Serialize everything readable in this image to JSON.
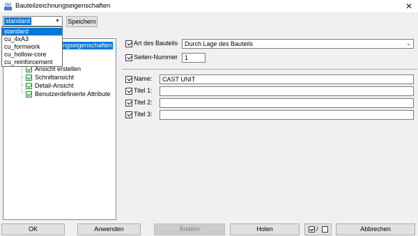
{
  "window": {
    "title": "Bauteilzeichnungseigenschaften",
    "close_glyph": "✕"
  },
  "toolbar": {
    "preset_value": "standard",
    "save_label": "Speichern",
    "preset_options": [
      "standard",
      "cu_4xA3",
      "cu_formwork",
      "cu_hollow-core",
      "cu_reinforcement"
    ]
  },
  "tree": {
    "root_partial_label": "ngseigenschaften",
    "items": [
      "Ansicht erstellen",
      "Schnittansicht",
      "Detail-Ansicht",
      "Benutzerdefinierte Attribute"
    ]
  },
  "props": {
    "art_label": "Art des Bauteils",
    "art_value": "Durch Lage des Bauteils",
    "seiten_label": "Seiten-Nummer",
    "seiten_value": "1",
    "name_label": "Name:",
    "name_value": "CAST UNIT",
    "titel1_label": "Titel 1:",
    "titel1_value": "",
    "titel2_label": "Titel 2:",
    "titel2_value": "",
    "titel3_label": "Titel 3:",
    "titel3_value": ""
  },
  "buttons": {
    "ok": "OK",
    "apply": "Anwenden",
    "modify": "Ändern",
    "get": "Holen",
    "toggle_sep": "/",
    "cancel": "Abbrechen"
  },
  "colors": {
    "selection": "#0078d7",
    "dialog_bg": "#f0f0f0",
    "check_green": "#2a8a2a"
  }
}
